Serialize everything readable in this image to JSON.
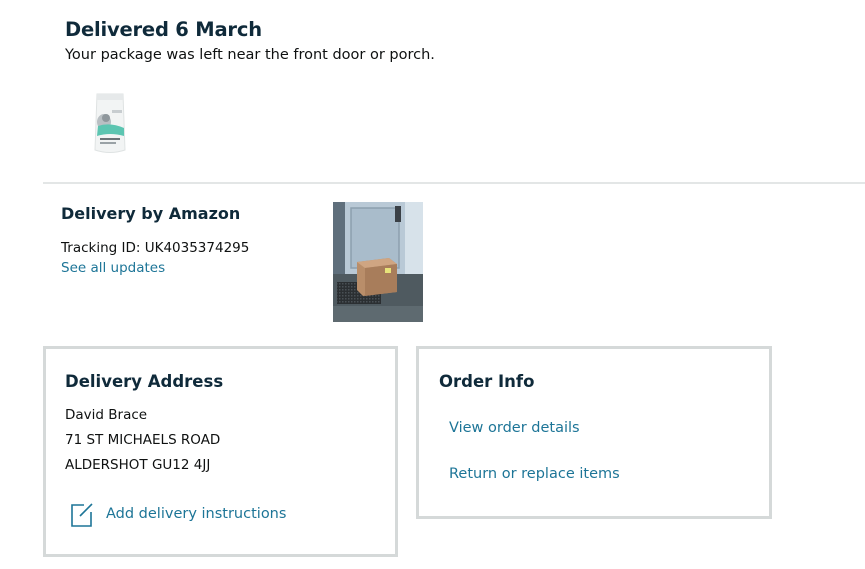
{
  "header": {
    "title": "Delivered 6 March",
    "subtitle": "Your package was left near the front door or porch."
  },
  "carrier": {
    "title": "Delivery by Amazon",
    "tracking": "Tracking ID: UK4035374295",
    "see_updates": "See all updates"
  },
  "address_card": {
    "title": "Delivery Address",
    "lines": [
      "David Brace",
      "71 ST MICHAELS ROAD",
      "ALDERSHOT GU12 4JJ"
    ],
    "instructions_label": "Add delivery instructions"
  },
  "order_card": {
    "title": "Order Info",
    "view_details": "View order details",
    "return_replace": "Return or replace items"
  },
  "icons": {
    "instructions": "edit-note-icon"
  },
  "colors": {
    "link": "#1d7597",
    "heading": "#0f2a3a",
    "border": "#d5d9d9"
  }
}
